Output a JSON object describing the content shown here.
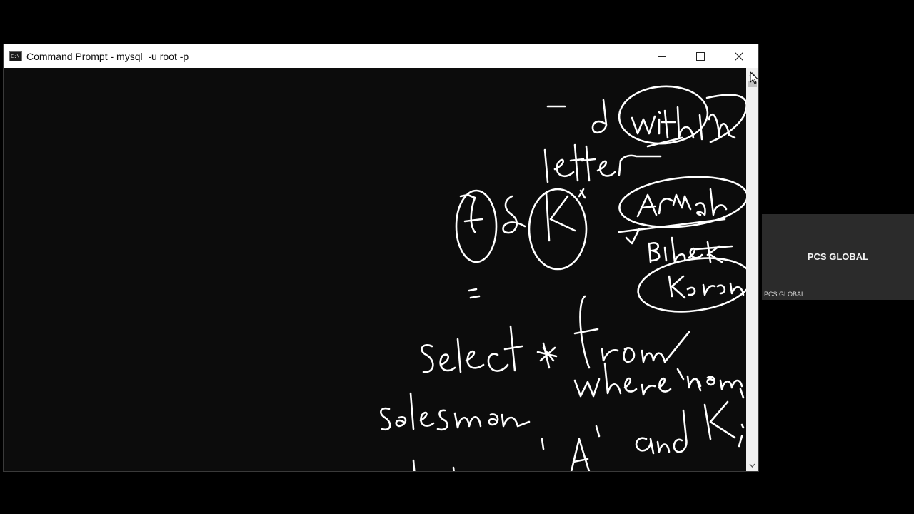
{
  "window": {
    "title": "Command Prompt - mysql  -u root -p",
    "icon": "cmd-icon",
    "controls": [
      "minimize-icon",
      "maximize-icon",
      "close-icon"
    ]
  },
  "colors": {
    "console_bg": "#0c0c0c",
    "ink": "#ffffff",
    "titlebar": "#ffffff",
    "tile_bg": "#2b2b2b"
  },
  "participant_tile": {
    "name": "PCS GLOBAL",
    "caption": "PCS GLOBAL"
  }
}
